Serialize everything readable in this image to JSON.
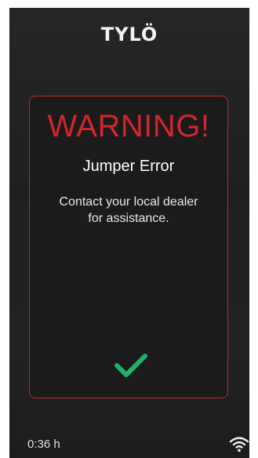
{
  "brand": {
    "logo_text": "TYLÖ"
  },
  "dialog": {
    "title": "WARNING!",
    "subtitle": "Jumper Error",
    "message_line1": "Contact your local dealer",
    "message_line2": "for assistance.",
    "confirm_icon": "checkmark-icon"
  },
  "status_bar": {
    "time": "0:36 h",
    "wifi_icon": "wifi-icon"
  },
  "colors": {
    "warning": "#d1262e",
    "confirm": "#1fb26b",
    "background": "#222222"
  }
}
